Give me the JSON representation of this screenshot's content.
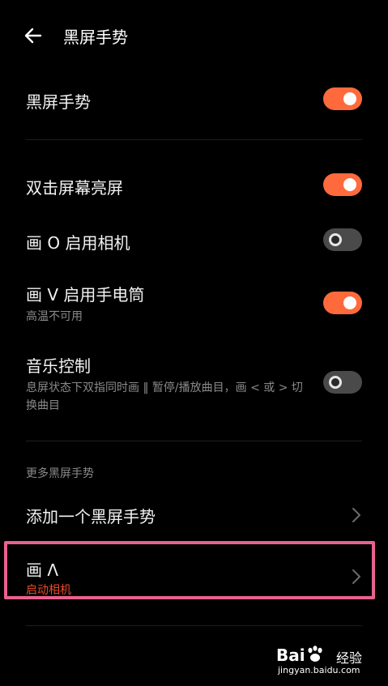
{
  "header": {
    "title": "黑屏手势"
  },
  "main_toggle": {
    "label": "黑屏手势",
    "on": true
  },
  "gestures": [
    {
      "label": "双击屏幕亮屏",
      "sub": "",
      "on": true
    },
    {
      "label": "画 O 启用相机",
      "sub": "",
      "on": false
    },
    {
      "label": "画 V 启用手电筒",
      "sub": "高温不可用",
      "on": true
    },
    {
      "label": "音乐控制",
      "sub": "息屏状态下双指同时画 ‖ 暂停/播放曲目，画 < 或 > 切换曲目",
      "on": false
    }
  ],
  "more": {
    "section_title": "更多黑屏手势",
    "add_label": "添加一个黑屏手势",
    "custom_label": "画 Λ",
    "custom_sub": "启动相机"
  },
  "watermark": {
    "brand": "Bai",
    "brand2": "经验",
    "url": "jingyan.baidu.com"
  },
  "colors": {
    "accent": "#ff6a3d",
    "highlight": "#e8628d",
    "background": "#000000"
  }
}
